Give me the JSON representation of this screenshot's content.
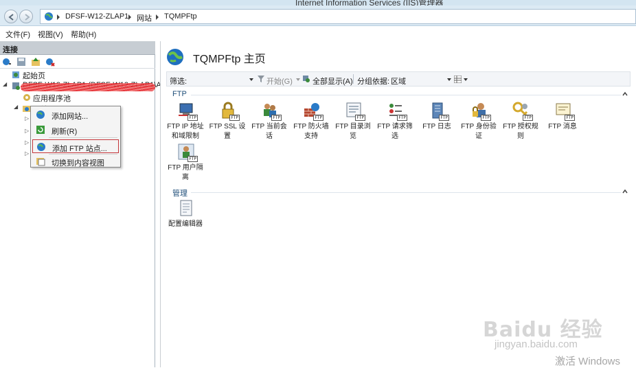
{
  "window": {
    "title": "Internet Information Services (IIS)管理器"
  },
  "address": {
    "crumbs": [
      "DFSF-W12-ZLAP1",
      "网站",
      "TQMPFtp"
    ]
  },
  "menu": {
    "file": "文件(F)",
    "view": "视图(V)",
    "help": "帮助(H)"
  },
  "connections": {
    "header": "连接",
    "tree": {
      "start_page": "起始页",
      "server": "DFSF-W12-ZLAP1 (DFSF-W12-ZLAP1\\Adm",
      "app_pools": "应用程序池",
      "sites": "网站"
    }
  },
  "context_menu": {
    "items": [
      "添加网站...",
      "刷新(R)",
      "添加 FTP 站点...",
      "切换到内容视图"
    ]
  },
  "main": {
    "title": "TQMPFtp 主页",
    "filter": {
      "label": "筛选:",
      "start": "开始(G)",
      "show_all": "全部显示(A)",
      "group_by_label": "分组依据:",
      "group_by_value": "区域"
    },
    "sections": [
      {
        "name": "FTP",
        "features": [
          {
            "label": "FTP IP 地址和域限制",
            "icon": "ip-restrictions-icon"
          },
          {
            "label": "FTP SSL 设置",
            "icon": "ssl-lock-icon"
          },
          {
            "label": "FTP 当前会话",
            "icon": "sessions-icon"
          },
          {
            "label": "FTP 防火墙支持",
            "icon": "firewall-icon"
          },
          {
            "label": "FTP 目录浏览",
            "icon": "directory-browsing-icon"
          },
          {
            "label": "FTP 请求筛选",
            "icon": "request-filtering-icon"
          },
          {
            "label": "FTP 日志",
            "icon": "logging-icon"
          },
          {
            "label": "FTP 身份验证",
            "icon": "authentication-icon"
          },
          {
            "label": "FTP 授权规则",
            "icon": "authorization-icon"
          },
          {
            "label": "FTP 消息",
            "icon": "messages-icon"
          },
          {
            "label": "FTP 用户隔离",
            "icon": "user-isolation-icon"
          }
        ]
      },
      {
        "name": "管理",
        "features": [
          {
            "label": "配置编辑器",
            "icon": "config-editor-icon"
          }
        ]
      }
    ]
  },
  "watermarks": {
    "baidu_logo": "Baidu 经验",
    "baidu_url": "jingyan.baidu.com",
    "activate": "激活 Windows"
  },
  "colors": {
    "accent": "#1f4e79",
    "highlight_border": "#c4353a",
    "redaction": "#e4242a"
  }
}
